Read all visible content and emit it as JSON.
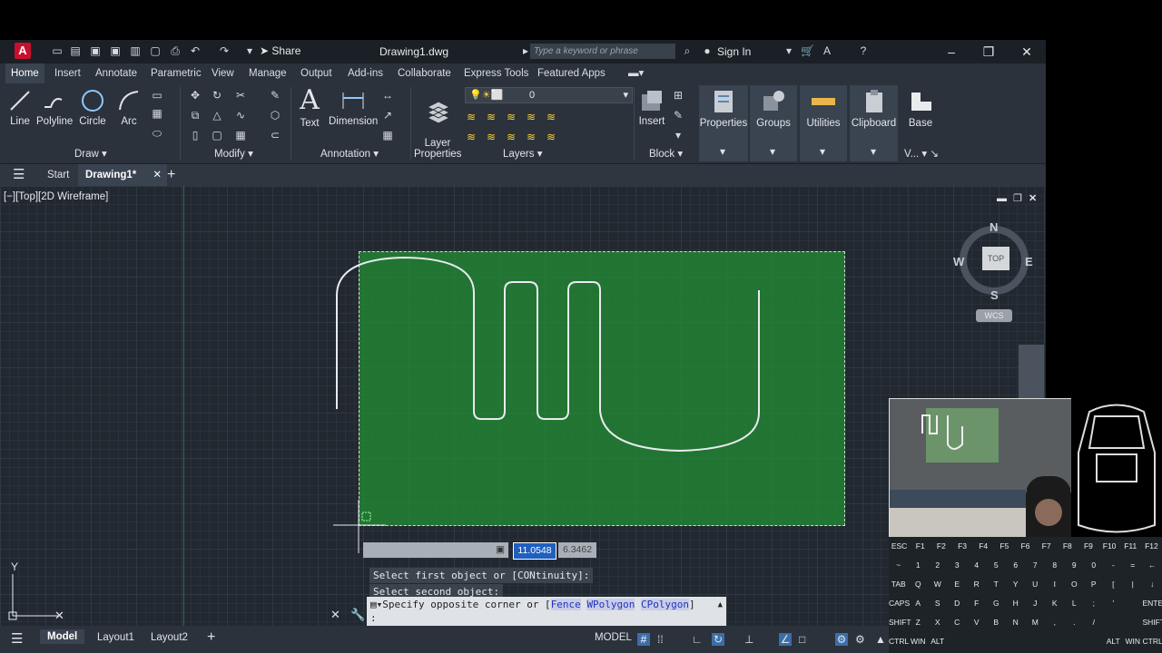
{
  "app": {
    "logo": "A",
    "title": "Drawing1.dwg",
    "share_label": "Share",
    "search_placeholder": "Type a keyword or phrase",
    "signin_label": "Sign In"
  },
  "menu_tabs": [
    "Home",
    "Insert",
    "Annotate",
    "Parametric",
    "View",
    "Manage",
    "Output",
    "Add-ins",
    "Collaborate",
    "Express Tools",
    "Featured Apps"
  ],
  "ribbon": {
    "draw": {
      "items": [
        "Line",
        "Polyline",
        "Circle",
        "Arc"
      ],
      "label": "Draw"
    },
    "modify": {
      "label": "Modify"
    },
    "annotation": {
      "items": [
        "Text",
        "Dimension"
      ],
      "label": "Annotation"
    },
    "layers": {
      "layer_properties": "Layer\nProperties",
      "current_layer": "0",
      "label": "Layers"
    },
    "block": {
      "insert": "Insert",
      "label": "Block"
    },
    "properties": "Properties",
    "groups": "Groups",
    "utilities": "Utilities",
    "clipboard": "Clipboard",
    "base": "Base",
    "view_short": "V..."
  },
  "file_tabs": {
    "start": "Start",
    "drawing": "Drawing1*"
  },
  "viewport": {
    "label": "[−][Top][2D Wireframe]",
    "compass": {
      "n": "N",
      "s": "S",
      "e": "E",
      "w": "W",
      "top": "TOP"
    },
    "wcs": "WCS",
    "axis_y": "Y",
    "dyn_input": {
      "value1": "11.0548",
      "value2": "6.3462"
    },
    "prompts": [
      "Select first object or [CONtinuity]:",
      "Select second object:"
    ]
  },
  "command_line": {
    "text": "Specify opposite corner or [",
    "options": [
      "Fence",
      "WPolygon",
      "CPolygon"
    ],
    "close": "]",
    "input": ":"
  },
  "status": {
    "tabs": [
      "Model",
      "Layout1",
      "Layout2"
    ],
    "mode": "MODEL"
  },
  "keyboard": {
    "row1": [
      "ESC",
      "F1",
      "F2",
      "F3",
      "F4",
      "F5",
      "F6",
      "F7",
      "F8",
      "F9",
      "F10",
      "F11",
      "F12"
    ],
    "row2": [
      "~",
      "1",
      "2",
      "3",
      "4",
      "5",
      "6",
      "7",
      "8",
      "9",
      "0",
      "-",
      "=",
      "←"
    ],
    "row3": [
      "TAB",
      "Q",
      "W",
      "E",
      "R",
      "T",
      "Y",
      "U",
      "I",
      "O",
      "P",
      "[",
      "|",
      "↓"
    ],
    "row4": [
      "CAPS",
      "A",
      "S",
      "D",
      "F",
      "G",
      "H",
      "J",
      "K",
      "L",
      ";",
      "'",
      "",
      "ENTER"
    ],
    "row5": [
      "SHIFT",
      "Z",
      "X",
      "C",
      "V",
      "B",
      "N",
      "M",
      ",",
      ".",
      "/",
      "",
      "",
      "SHIFT"
    ],
    "row6": [
      "CTRL",
      "WIN",
      "ALT",
      "",
      "",
      "",
      "",
      "",
      "",
      "",
      "",
      "ALT",
      "WIN",
      "CTRL"
    ]
  },
  "colors": {
    "selection": "#228b35",
    "background": "#212830",
    "ribbon": "#2b323b"
  }
}
